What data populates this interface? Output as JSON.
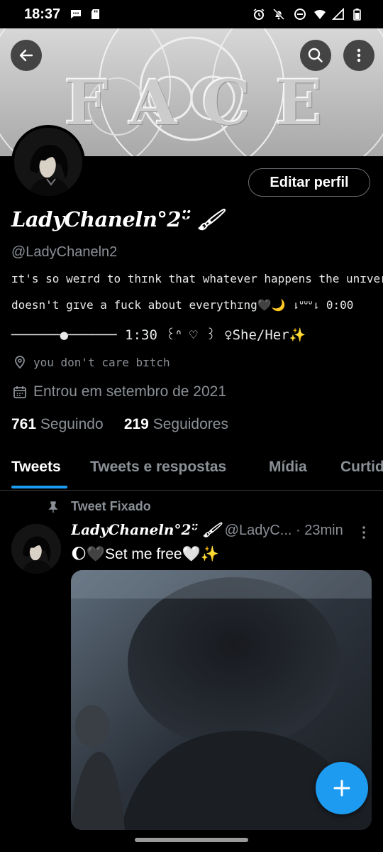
{
  "status_bar": {
    "time": "18:37",
    "left_icons": [
      "chat-notification-icon",
      "sd-card-icon"
    ],
    "right_icons": [
      "alarm-icon",
      "bell-off-icon",
      "do-not-disturb-icon",
      "wifi-icon",
      "signal-icon",
      "battery-icon"
    ]
  },
  "header": {
    "back_icon": "arrow-left-icon",
    "search_icon": "search-icon",
    "more_icon": "more-vertical-icon"
  },
  "banner": {
    "text": "FACE"
  },
  "profile": {
    "edit_button": "Editar perfil",
    "display_name": "LadyChaneln°2ᵕ̈ 🖌",
    "handle": "@LadyChaneln2",
    "bio_line1": "ɪt's so weɪrd to thɪnk that whatever happens the unɪverse",
    "bio_line2": "doesn't gɪve a fuck about everythɪng🖤🌙 ⇂ᐡᐡᐡ⇂ 0:00",
    "bio_line3": "──────●──────  1:30  ꒰ᐢ ♡ ꒱  ♀She/Her✨",
    "location": "you don't care bɪtch",
    "joined": "Entrou em setembro de 2021",
    "following_count": "761",
    "following_label": "Seguindo",
    "followers_count": "219",
    "followers_label": "Seguidores"
  },
  "tabs": [
    {
      "label": "Tweets",
      "active": true
    },
    {
      "label": "Tweets e respostas",
      "active": false
    },
    {
      "label": "Mídia",
      "active": false
    },
    {
      "label": "Curtidas",
      "active": false
    }
  ],
  "tweet": {
    "pinned_label": "Tweet Fixado",
    "author_name": "LadyChaneln°2ᵕ̈ 🖌",
    "author_handle": "@LadyC...",
    "separator": "·",
    "time": "23min",
    "text": "🌔🖤Set me free🤍✨"
  },
  "colors": {
    "accent": "#1d9bf0",
    "background": "#000000",
    "secondary_text": "#8b9096"
  },
  "fab": {
    "icon": "plus-icon"
  }
}
